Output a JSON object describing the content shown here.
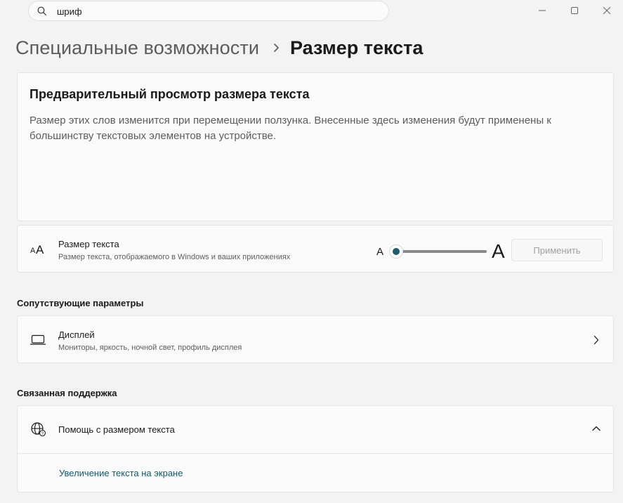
{
  "search": {
    "value": "шриф"
  },
  "breadcrumb": {
    "parent": "Специальные возможности",
    "current": "Размер текста"
  },
  "preview": {
    "title": "Предварительный просмотр размера текста",
    "description": "Размер этих слов изменится при перемещении ползунка. Внесенные здесь изменения будут применены к большинству текстовых элементов на устройстве."
  },
  "text_size": {
    "title": "Размер текста",
    "subtitle": "Размер текста, отображаемого в Windows и ваших приложениях",
    "small_a": "A",
    "big_a": "A",
    "slider_value_percent": 0,
    "apply_label": "Применить"
  },
  "related": {
    "heading": "Сопутствующие параметры",
    "display_title": "Дисплей",
    "display_subtitle": "Мониторы, яркость, ночной свет, профиль дисплея"
  },
  "support": {
    "heading": "Связанная поддержка",
    "help_title": "Помощь с размером текста",
    "link": "Увеличение текста на экране"
  },
  "colors": {
    "accent": "#1b5e6e",
    "link": "#0f5a6e",
    "background": "#f3f3f3",
    "card": "#fbfbfb"
  }
}
